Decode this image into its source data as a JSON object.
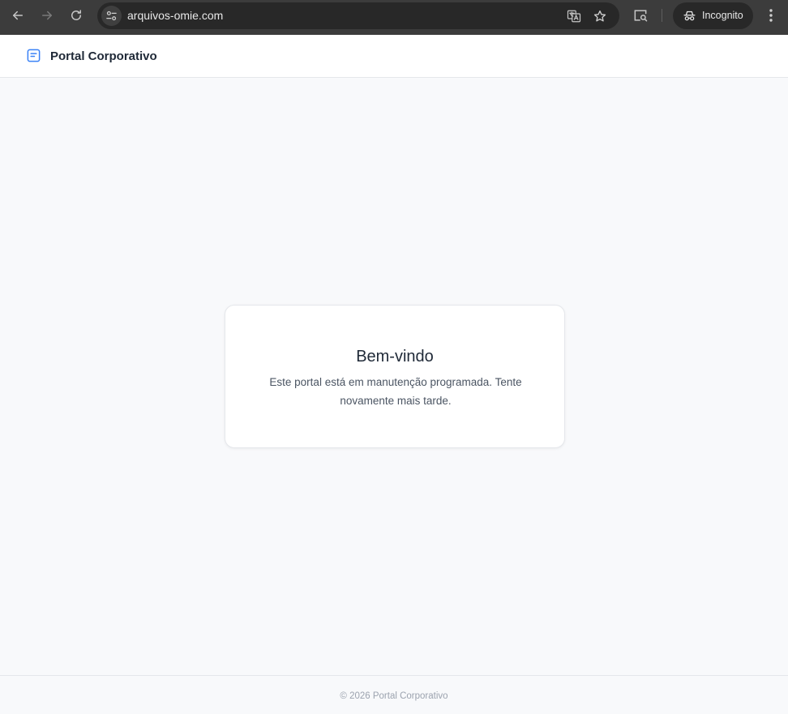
{
  "browser": {
    "url": "arquivos-omie.com",
    "incognito_label": "Incognito"
  },
  "header": {
    "title": "Portal Corporativo",
    "logo_icon": "document-icon",
    "accent_color": "#3b82f6"
  },
  "card": {
    "title": "Bem-vindo",
    "message": "Este portal está em manutenção programada. Tente novamente mais tarde."
  },
  "footer": {
    "text": "© 2026 Portal Corporativo"
  }
}
